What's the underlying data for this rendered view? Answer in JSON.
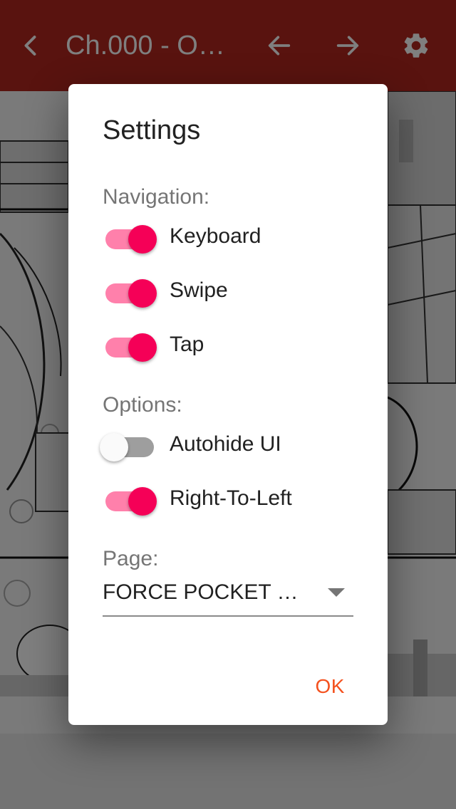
{
  "appbar": {
    "title": "Ch.000 - O…",
    "colors": {
      "background": "#b3261e",
      "foreground": "#ffffff"
    },
    "icons": [
      "back-chevron-icon",
      "arrow-left-icon",
      "arrow-right-icon",
      "gear-icon"
    ]
  },
  "dialog": {
    "title": "Settings",
    "navigation_label": "Navigation:",
    "navigation": [
      {
        "label": "Keyboard",
        "on": true
      },
      {
        "label": "Swipe",
        "on": true
      },
      {
        "label": "Tap",
        "on": true
      }
    ],
    "options_label": "Options:",
    "options": [
      {
        "label": "Autohide UI",
        "on": false
      },
      {
        "label": "Right-To-Left",
        "on": true
      }
    ],
    "page_label": "Page:",
    "page_value": "FORCE POCKET …",
    "ok_label": "OK",
    "colors": {
      "switch_on": "#f50057",
      "switch_on_track": "#ff80ab",
      "ok": "#f4511e"
    }
  }
}
